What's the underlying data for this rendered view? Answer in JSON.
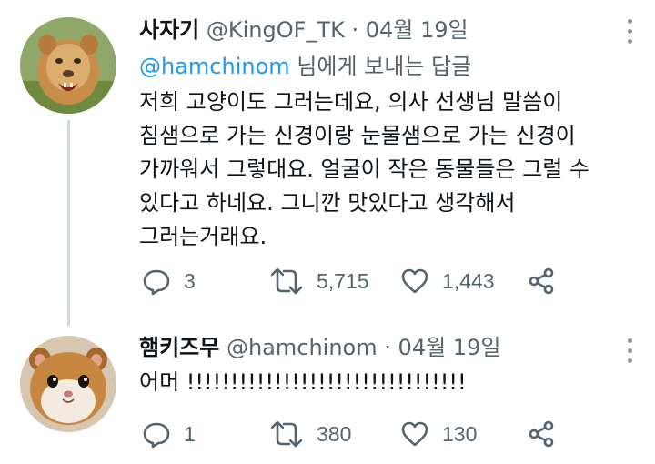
{
  "tweets": [
    {
      "name": "사자기",
      "handle": "@KingOF_TK",
      "separator": "·",
      "date": "04월 19일",
      "reply_mention": "@hamchinom",
      "reply_suffix": "님에게 보내는 답글",
      "text_lines": [
        "저희 고양이도 그러는데요, 의사 선생님 말씀이",
        "침샘으로 가는 신경이랑 눈물샘으로 가는 신경이",
        "가까워서 그렇대요. 얼굴이 작은 동물들은 그럴 수",
        "있다고 하네요. 그니깐 맛있다고 생각해서",
        "그러는거래요."
      ],
      "replies": "3",
      "retweets": "5,715",
      "likes": "1,443",
      "avatar_icon": "lion-cub-avatar"
    },
    {
      "name": "햄키즈무",
      "handle": "@hamchinom",
      "separator": "·",
      "date": "04월 19일",
      "text_lines": [
        "어머 !!!!!!!!!!!!!!!!!!!!!!!!!!!!!!!!"
      ],
      "replies": "1",
      "retweets": "380",
      "likes": "130",
      "avatar_icon": "hamster-avatar"
    }
  ],
  "colors": {
    "link": "#1d9bf0",
    "secondary": "#536471",
    "thread": "#cfd9de"
  }
}
